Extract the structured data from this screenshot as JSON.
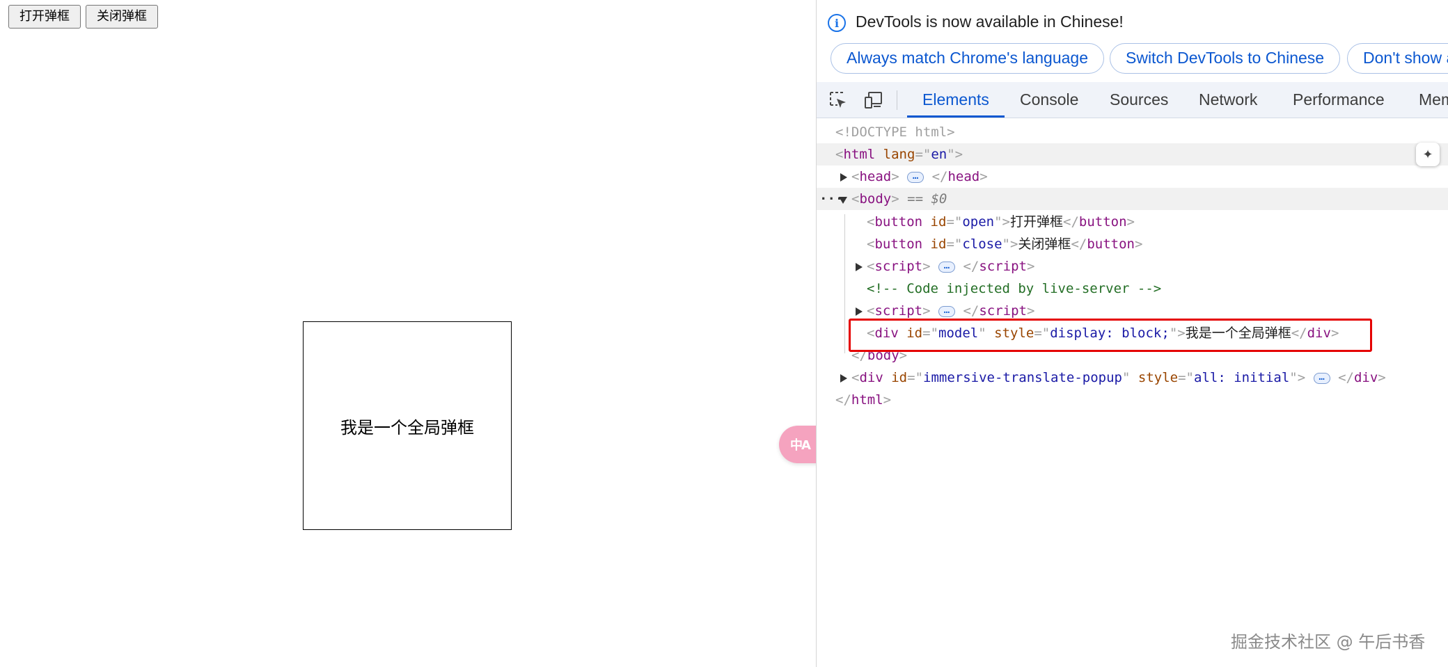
{
  "page": {
    "open_button": "打开弹框",
    "close_button": "关闭弹框",
    "modal_text": "我是一个全局弹框",
    "translate_fab": "中A"
  },
  "devtools": {
    "infobar": {
      "message": "DevTools is now available in Chinese!",
      "buttons": [
        "Always match Chrome's language",
        "Switch DevTools to Chinese",
        "Don't show again"
      ]
    },
    "tabs": [
      "Elements",
      "Console",
      "Sources",
      "Network",
      "Performance",
      "Memory"
    ],
    "active_tab": "Elements",
    "dom": {
      "doctype": "<!DOCTYPE html>",
      "html_open": "html",
      "html_lang_attr": "lang",
      "html_lang_val": "en",
      "head": "head",
      "body": "body",
      "body_eq": "== $0",
      "btn_open_id": "open",
      "btn_open_text": "打开弹框",
      "btn_close_id": "close",
      "btn_close_text": "关闭弹框",
      "script": "script",
      "comment": "<!-- Code injected by live-server -->",
      "div_model_id": "model",
      "div_model_style": "display: block;",
      "div_model_text": "我是一个全局弹框",
      "div_popup_id": "immersive-translate-popup",
      "div_popup_style": "all: initial",
      "tag_button": "button",
      "tag_div": "div",
      "attr_id": "id",
      "attr_style": "style"
    }
  },
  "watermark": "掘金技术社区 @ 午后书香",
  "colors": {
    "accent": "#0b57d0",
    "highlight_border": "#e50000",
    "tag": "#881280",
    "attr": "#994500",
    "value": "#1a1aa6",
    "comment": "#236e25"
  }
}
